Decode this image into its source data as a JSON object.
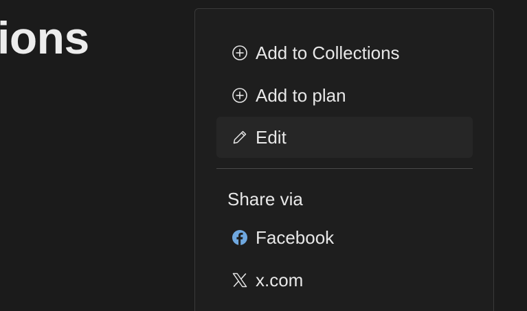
{
  "background": {
    "heading_fragment": "ions"
  },
  "menu": {
    "items": [
      {
        "label": "Add to Collections",
        "icon": "plus-circle-icon"
      },
      {
        "label": "Add to plan",
        "icon": "plus-circle-icon"
      },
      {
        "label": "Edit",
        "icon": "pencil-icon"
      }
    ],
    "share_label": "Share via",
    "share_items": [
      {
        "label": "Facebook",
        "icon": "facebook-icon",
        "color": "#6fa8e0"
      },
      {
        "label": "x.com",
        "icon": "x-logo-icon"
      }
    ]
  }
}
